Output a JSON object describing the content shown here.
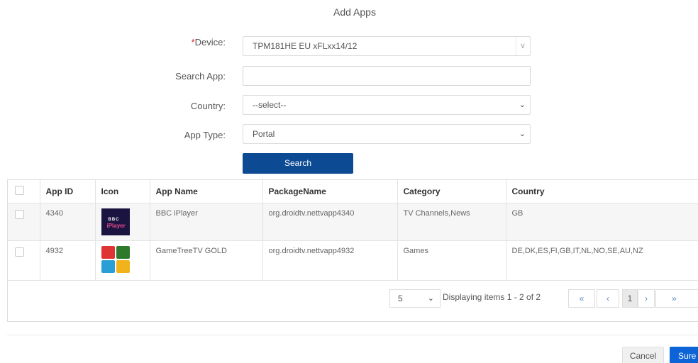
{
  "dialog": {
    "title": "Add Apps"
  },
  "form": {
    "device": {
      "required_mark": "*",
      "label": "Device:",
      "value": "TPM181HE EU xFLxx14/12"
    },
    "search_app": {
      "label": "Search App:",
      "value": ""
    },
    "country": {
      "label": "Country:",
      "value": "--select--"
    },
    "app_type": {
      "label": "App Type:",
      "value": "Portal"
    },
    "search_button": "Search"
  },
  "table": {
    "columns": [
      "App ID",
      "Icon",
      "App Name",
      "PackageName",
      "Category",
      "Country"
    ],
    "rows": [
      {
        "app_id": "4340",
        "icon": "bbc-iplayer-icon",
        "app_name": "BBC iPlayer",
        "package": "org.droidtv.nettvapp4340",
        "category": "TV Channels,News",
        "country": "GB"
      },
      {
        "app_id": "4932",
        "icon": "gametreetv-icon",
        "app_name": "GameTreeTV GOLD",
        "package": "org.droidtv.nettvapp4932",
        "category": "Games",
        "country": "DE,DK,ES,FI,GB,IT,NL,NO,SE,AU,NZ"
      }
    ],
    "icon_text": {
      "bbc_line1": "BBC",
      "bbc_line2": "iPlayer"
    }
  },
  "pagination": {
    "page_size": "5",
    "display_text": "Displaying items 1 - 2 of 2",
    "first": "«",
    "prev": "‹",
    "current": "1",
    "next": "›",
    "last": "»"
  },
  "actions": {
    "cancel": "Cancel",
    "sure": "Sure"
  },
  "colors": {
    "primary": "#0d4a94",
    "sure": "#0d64d6",
    "required": "#e02020"
  }
}
